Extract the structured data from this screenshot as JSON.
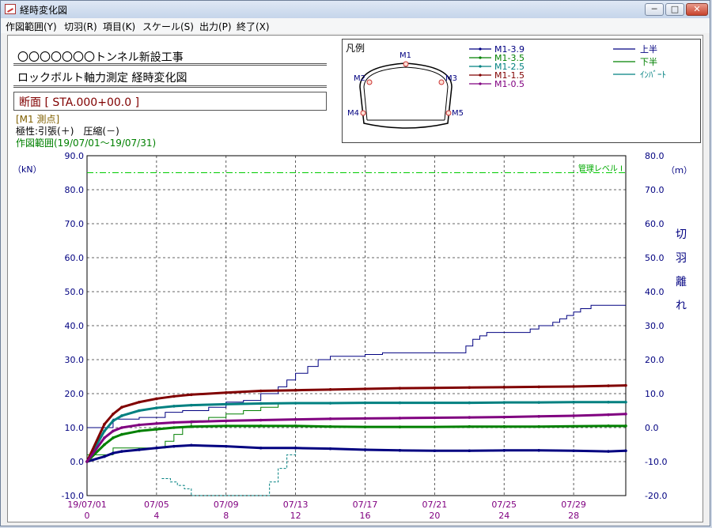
{
  "window": {
    "title": "経時変化図"
  },
  "menu": [
    "作図範囲(Y)",
    "切羽(R)",
    "項目(K)",
    "スケール(S)",
    "出力(P)",
    "終了(X)"
  ],
  "header": {
    "project": "〇〇〇〇〇〇〇トンネル新設工事",
    "subtitle": "ロックボルト軸力測定 経時変化図",
    "section": "断面 [ STA.000+00.0 ]",
    "point": "[M1 測点]",
    "polarity": "極性:引張(＋)　圧縮(－)",
    "range": "作図範囲(19/07/01～19/07/31)"
  },
  "legend": {
    "title": "凡例",
    "points": [
      "M1",
      "M2",
      "M3",
      "M4",
      "M5"
    ],
    "series": [
      {
        "name": "M1-3.9",
        "color": "#000080"
      },
      {
        "name": "M1-3.5",
        "color": "#008000"
      },
      {
        "name": "M1-2.5",
        "color": "#008080"
      },
      {
        "name": "M1-1.5",
        "color": "#800000"
      },
      {
        "name": "M1-0.5",
        "color": "#800080"
      }
    ],
    "excavation": [
      {
        "name": "上半",
        "color": "#000080"
      },
      {
        "name": "下半",
        "color": "#008000"
      },
      {
        "name": "ｲﾝﾊﾞｰﾄ",
        "color": "#008080"
      }
    ]
  },
  "chart_data": {
    "type": "line",
    "ylabel": "（kN）",
    "y2label": "（ｍ）",
    "y2label_vertical": [
      "切",
      "羽",
      "離",
      "れ"
    ],
    "ylim": [
      -10,
      90
    ],
    "y2lim": [
      -20,
      80
    ],
    "yticks": [
      "90.0",
      "80.0",
      "70.0",
      "60.0",
      "50.0",
      "40.0",
      "30.0",
      "20.0",
      "10.0",
      "0.0",
      "-10.0"
    ],
    "y2ticks": [
      "80.0",
      "70.0",
      "60.0",
      "50.0",
      "40.0",
      "30.0",
      "20.0",
      "10.0",
      "0.0",
      "-10.0",
      "-20.0"
    ],
    "xticks": [
      "19/07/01",
      "07/05",
      "07/09",
      "07/13",
      "07/17",
      "07/21",
      "07/25",
      "07/29"
    ],
    "xticks_day": [
      "0",
      "4",
      "8",
      "12",
      "16",
      "20",
      "24",
      "28"
    ],
    "xlim": [
      0,
      31
    ],
    "control_level": {
      "label": "管理レベル I",
      "value": 85
    },
    "series": [
      {
        "name": "M1-3.9",
        "color": "#000080",
        "x": [
          0,
          1,
          1.5,
          2,
          3,
          4,
          5,
          6,
          8,
          10,
          12,
          14,
          16,
          18,
          20,
          22,
          24,
          26,
          28,
          30,
          31
        ],
        "y": [
          0,
          1.5,
          2.5,
          3,
          3.5,
          4,
          4.5,
          4.8,
          4.5,
          4,
          4,
          3.8,
          3.5,
          3.3,
          3.2,
          3.2,
          3.3,
          3.3,
          3.2,
          3,
          3.2
        ]
      },
      {
        "name": "M1-3.5",
        "color": "#008000",
        "x": [
          0,
          1,
          1.5,
          2,
          3,
          4,
          5,
          6,
          8,
          10,
          12,
          14,
          16,
          18,
          20,
          22,
          24,
          26,
          28,
          30,
          31
        ],
        "y": [
          0,
          5,
          7,
          8,
          9,
          9.5,
          10,
          10.3,
          10.5,
          10.5,
          10.5,
          10.3,
          10.2,
          10.2,
          10.2,
          10.3,
          10.3,
          10.3,
          10.4,
          10.5,
          10.5
        ]
      },
      {
        "name": "M1-2.5",
        "color": "#008080",
        "x": [
          0,
          1,
          1.5,
          2,
          3,
          4,
          5,
          6,
          8,
          10,
          12,
          14,
          16,
          18,
          20,
          22,
          24,
          26,
          28,
          30,
          31
        ],
        "y": [
          0,
          9,
          12,
          13.5,
          15,
          15.8,
          16.3,
          16.6,
          16.9,
          17.1,
          17.2,
          17.2,
          17.3,
          17.3,
          17.3,
          17.3,
          17.4,
          17.4,
          17.5,
          17.5,
          17.5
        ]
      },
      {
        "name": "M1-1.5",
        "color": "#800000",
        "x": [
          0,
          1,
          1.5,
          2,
          3,
          4,
          5,
          6,
          8,
          10,
          12,
          14,
          16,
          18,
          20,
          22,
          24,
          26,
          28,
          30,
          31
        ],
        "y": [
          0,
          11,
          14,
          16,
          17.5,
          18.5,
          19.2,
          19.7,
          20.3,
          20.8,
          21,
          21.2,
          21.4,
          21.6,
          21.7,
          21.8,
          21.9,
          22,
          22.1,
          22.3,
          22.4
        ]
      },
      {
        "name": "M1-0.5",
        "color": "#800080",
        "x": [
          0,
          1,
          1.5,
          2,
          3,
          4,
          5,
          6,
          8,
          10,
          12,
          14,
          16,
          18,
          20,
          22,
          24,
          26,
          28,
          30,
          31
        ],
        "y": [
          0,
          7,
          9,
          10,
          10.8,
          11.2,
          11.5,
          11.7,
          12,
          12.2,
          12.4,
          12.6,
          12.7,
          12.8,
          12.9,
          13,
          13.1,
          13.3,
          13.5,
          13.8,
          14
        ]
      }
    ],
    "excavation_series": [
      {
        "name": "上半",
        "color": "#000080",
        "step": true,
        "x": [
          0,
          1,
          1.5,
          3,
          4.5,
          5.5,
          7,
          8,
          9,
          10,
          11,
          11.5,
          12,
          12.7,
          13.3,
          14,
          15,
          16,
          17,
          18,
          20,
          21,
          21.8,
          22.2,
          22.6,
          23,
          25,
          25.5,
          26,
          26.8,
          27.2,
          27.6,
          28,
          28.4,
          29,
          29.3,
          31
        ],
        "y": [
          0,
          0,
          2.5,
          3,
          4.5,
          5,
          6,
          7.5,
          8,
          10,
          12,
          14,
          16,
          18,
          20,
          21,
          21,
          21.5,
          22,
          22,
          22,
          22,
          24,
          26,
          27,
          28,
          28,
          29,
          30,
          31,
          32,
          33,
          34,
          35,
          36,
          36,
          36
        ]
      },
      {
        "name": "下半",
        "color": "#008000",
        "step": true,
        "x": [
          0,
          1,
          1.5,
          3,
          4.5,
          5,
          5.5,
          6,
          7,
          8,
          9,
          10,
          11,
          12
        ],
        "y": [
          -8,
          -8,
          -6,
          -6,
          -4,
          -2,
          0,
          2,
          3,
          4,
          5,
          6,
          7,
          7
        ]
      },
      {
        "name": "ｲﾝﾊﾞｰﾄ",
        "color": "#008080",
        "step": true,
        "x": [
          4.3,
          4.8,
          5.2,
          5.6,
          6,
          10,
          10.5,
          11,
          11.5,
          12
        ],
        "y": [
          -15,
          -16,
          -17,
          -18,
          -20,
          -20,
          -16,
          -12,
          -8,
          -7
        ]
      }
    ]
  }
}
